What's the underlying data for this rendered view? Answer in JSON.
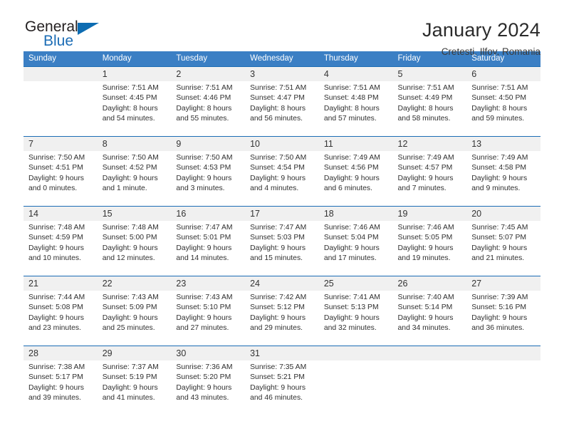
{
  "brand": {
    "name_part1": "General",
    "name_part2": "Blue",
    "triangle_color": "#0d6cb2"
  },
  "header": {
    "title": "January 2024",
    "subtitle": "Cretesti, Ilfov, Romania"
  },
  "colors": {
    "header_band": "#3b7fc4",
    "week_divider": "#1b6cb5",
    "day_number_band": "#f0f0f0",
    "text": "#2f2f2f"
  },
  "weekdays": [
    "Sunday",
    "Monday",
    "Tuesday",
    "Wednesday",
    "Thursday",
    "Friday",
    "Saturday"
  ],
  "weeks": [
    [
      {
        "day": "",
        "sunrise": "",
        "sunset": "",
        "daylight1": "",
        "daylight2": ""
      },
      {
        "day": "1",
        "sunrise": "Sunrise: 7:51 AM",
        "sunset": "Sunset: 4:45 PM",
        "daylight1": "Daylight: 8 hours",
        "daylight2": "and 54 minutes."
      },
      {
        "day": "2",
        "sunrise": "Sunrise: 7:51 AM",
        "sunset": "Sunset: 4:46 PM",
        "daylight1": "Daylight: 8 hours",
        "daylight2": "and 55 minutes."
      },
      {
        "day": "3",
        "sunrise": "Sunrise: 7:51 AM",
        "sunset": "Sunset: 4:47 PM",
        "daylight1": "Daylight: 8 hours",
        "daylight2": "and 56 minutes."
      },
      {
        "day": "4",
        "sunrise": "Sunrise: 7:51 AM",
        "sunset": "Sunset: 4:48 PM",
        "daylight1": "Daylight: 8 hours",
        "daylight2": "and 57 minutes."
      },
      {
        "day": "5",
        "sunrise": "Sunrise: 7:51 AM",
        "sunset": "Sunset: 4:49 PM",
        "daylight1": "Daylight: 8 hours",
        "daylight2": "and 58 minutes."
      },
      {
        "day": "6",
        "sunrise": "Sunrise: 7:51 AM",
        "sunset": "Sunset: 4:50 PM",
        "daylight1": "Daylight: 8 hours",
        "daylight2": "and 59 minutes."
      }
    ],
    [
      {
        "day": "7",
        "sunrise": "Sunrise: 7:50 AM",
        "sunset": "Sunset: 4:51 PM",
        "daylight1": "Daylight: 9 hours",
        "daylight2": "and 0 minutes."
      },
      {
        "day": "8",
        "sunrise": "Sunrise: 7:50 AM",
        "sunset": "Sunset: 4:52 PM",
        "daylight1": "Daylight: 9 hours",
        "daylight2": "and 1 minute."
      },
      {
        "day": "9",
        "sunrise": "Sunrise: 7:50 AM",
        "sunset": "Sunset: 4:53 PM",
        "daylight1": "Daylight: 9 hours",
        "daylight2": "and 3 minutes."
      },
      {
        "day": "10",
        "sunrise": "Sunrise: 7:50 AM",
        "sunset": "Sunset: 4:54 PM",
        "daylight1": "Daylight: 9 hours",
        "daylight2": "and 4 minutes."
      },
      {
        "day": "11",
        "sunrise": "Sunrise: 7:49 AM",
        "sunset": "Sunset: 4:56 PM",
        "daylight1": "Daylight: 9 hours",
        "daylight2": "and 6 minutes."
      },
      {
        "day": "12",
        "sunrise": "Sunrise: 7:49 AM",
        "sunset": "Sunset: 4:57 PM",
        "daylight1": "Daylight: 9 hours",
        "daylight2": "and 7 minutes."
      },
      {
        "day": "13",
        "sunrise": "Sunrise: 7:49 AM",
        "sunset": "Sunset: 4:58 PM",
        "daylight1": "Daylight: 9 hours",
        "daylight2": "and 9 minutes."
      }
    ],
    [
      {
        "day": "14",
        "sunrise": "Sunrise: 7:48 AM",
        "sunset": "Sunset: 4:59 PM",
        "daylight1": "Daylight: 9 hours",
        "daylight2": "and 10 minutes."
      },
      {
        "day": "15",
        "sunrise": "Sunrise: 7:48 AM",
        "sunset": "Sunset: 5:00 PM",
        "daylight1": "Daylight: 9 hours",
        "daylight2": "and 12 minutes."
      },
      {
        "day": "16",
        "sunrise": "Sunrise: 7:47 AM",
        "sunset": "Sunset: 5:01 PM",
        "daylight1": "Daylight: 9 hours",
        "daylight2": "and 14 minutes."
      },
      {
        "day": "17",
        "sunrise": "Sunrise: 7:47 AM",
        "sunset": "Sunset: 5:03 PM",
        "daylight1": "Daylight: 9 hours",
        "daylight2": "and 15 minutes."
      },
      {
        "day": "18",
        "sunrise": "Sunrise: 7:46 AM",
        "sunset": "Sunset: 5:04 PM",
        "daylight1": "Daylight: 9 hours",
        "daylight2": "and 17 minutes."
      },
      {
        "day": "19",
        "sunrise": "Sunrise: 7:46 AM",
        "sunset": "Sunset: 5:05 PM",
        "daylight1": "Daylight: 9 hours",
        "daylight2": "and 19 minutes."
      },
      {
        "day": "20",
        "sunrise": "Sunrise: 7:45 AM",
        "sunset": "Sunset: 5:07 PM",
        "daylight1": "Daylight: 9 hours",
        "daylight2": "and 21 minutes."
      }
    ],
    [
      {
        "day": "21",
        "sunrise": "Sunrise: 7:44 AM",
        "sunset": "Sunset: 5:08 PM",
        "daylight1": "Daylight: 9 hours",
        "daylight2": "and 23 minutes."
      },
      {
        "day": "22",
        "sunrise": "Sunrise: 7:43 AM",
        "sunset": "Sunset: 5:09 PM",
        "daylight1": "Daylight: 9 hours",
        "daylight2": "and 25 minutes."
      },
      {
        "day": "23",
        "sunrise": "Sunrise: 7:43 AM",
        "sunset": "Sunset: 5:10 PM",
        "daylight1": "Daylight: 9 hours",
        "daylight2": "and 27 minutes."
      },
      {
        "day": "24",
        "sunrise": "Sunrise: 7:42 AM",
        "sunset": "Sunset: 5:12 PM",
        "daylight1": "Daylight: 9 hours",
        "daylight2": "and 29 minutes."
      },
      {
        "day": "25",
        "sunrise": "Sunrise: 7:41 AM",
        "sunset": "Sunset: 5:13 PM",
        "daylight1": "Daylight: 9 hours",
        "daylight2": "and 32 minutes."
      },
      {
        "day": "26",
        "sunrise": "Sunrise: 7:40 AM",
        "sunset": "Sunset: 5:14 PM",
        "daylight1": "Daylight: 9 hours",
        "daylight2": "and 34 minutes."
      },
      {
        "day": "27",
        "sunrise": "Sunrise: 7:39 AM",
        "sunset": "Sunset: 5:16 PM",
        "daylight1": "Daylight: 9 hours",
        "daylight2": "and 36 minutes."
      }
    ],
    [
      {
        "day": "28",
        "sunrise": "Sunrise: 7:38 AM",
        "sunset": "Sunset: 5:17 PM",
        "daylight1": "Daylight: 9 hours",
        "daylight2": "and 39 minutes."
      },
      {
        "day": "29",
        "sunrise": "Sunrise: 7:37 AM",
        "sunset": "Sunset: 5:19 PM",
        "daylight1": "Daylight: 9 hours",
        "daylight2": "and 41 minutes."
      },
      {
        "day": "30",
        "sunrise": "Sunrise: 7:36 AM",
        "sunset": "Sunset: 5:20 PM",
        "daylight1": "Daylight: 9 hours",
        "daylight2": "and 43 minutes."
      },
      {
        "day": "31",
        "sunrise": "Sunrise: 7:35 AM",
        "sunset": "Sunset: 5:21 PM",
        "daylight1": "Daylight: 9 hours",
        "daylight2": "and 46 minutes."
      },
      {
        "day": "",
        "sunrise": "",
        "sunset": "",
        "daylight1": "",
        "daylight2": ""
      },
      {
        "day": "",
        "sunrise": "",
        "sunset": "",
        "daylight1": "",
        "daylight2": ""
      },
      {
        "day": "",
        "sunrise": "",
        "sunset": "",
        "daylight1": "",
        "daylight2": ""
      }
    ]
  ]
}
